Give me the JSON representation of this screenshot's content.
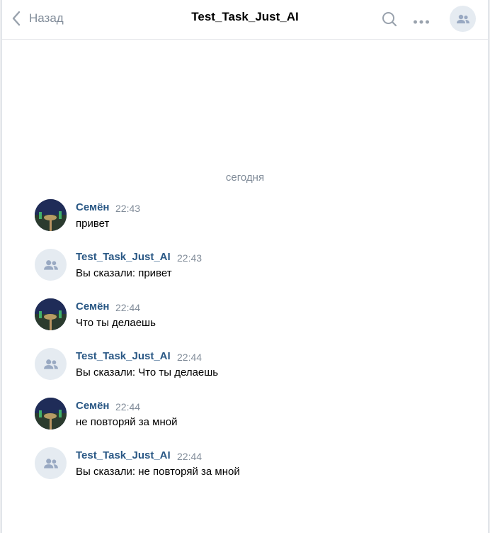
{
  "header": {
    "back_label": "Назад",
    "title": "Test_Task_Just_AI",
    "icons": {
      "back": "chevron-left-icon",
      "search": "search-icon",
      "more": "more-dots-icon",
      "group": "group-icon"
    }
  },
  "date_separator": "сегодня",
  "messages": [
    {
      "author": "Семён",
      "time": "22:43",
      "text": "привет",
      "avatar": "photo"
    },
    {
      "author": "Test_Task_Just_AI",
      "time": "22:43",
      "text": "Вы сказали: привет",
      "avatar": "group"
    },
    {
      "author": "Семён",
      "time": "22:44",
      "text": "Что ты делаешь",
      "avatar": "photo"
    },
    {
      "author": "Test_Task_Just_AI",
      "time": "22:44",
      "text": "Вы сказали: Что ты делаешь",
      "avatar": "group"
    },
    {
      "author": "Семён",
      "time": "22:44",
      "text": "не повторяй за мной",
      "avatar": "photo"
    },
    {
      "author": "Test_Task_Just_AI",
      "time": "22:44",
      "text": "Вы сказали: не повторяй за мной",
      "avatar": "group"
    }
  ],
  "colors": {
    "author": "#2a5885",
    "muted": "#818c99",
    "avatar_bg": "#e5ebf1"
  }
}
